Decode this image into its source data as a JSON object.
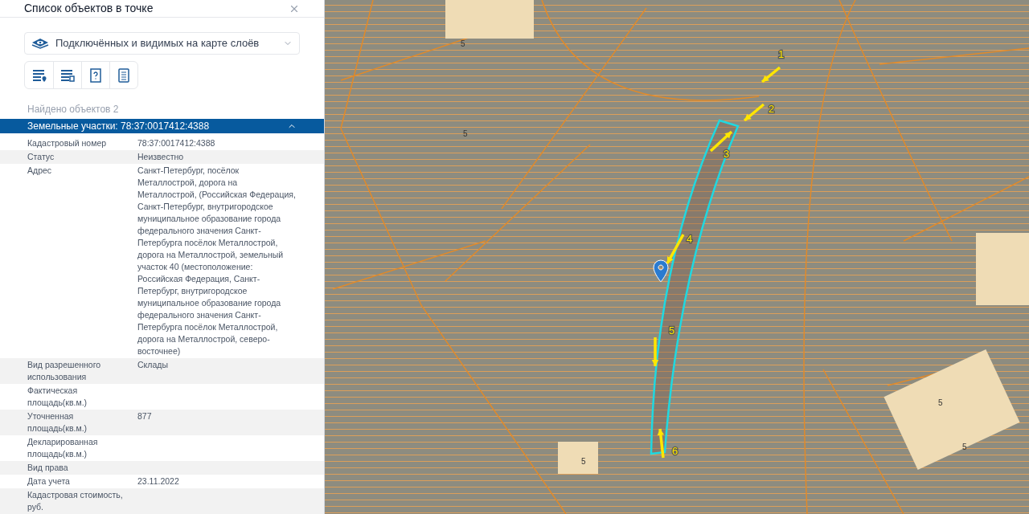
{
  "panel": {
    "title": "Список объектов в точке",
    "layer_select": {
      "value": "Подключённых и видимых на карте слоёв"
    },
    "tools": [
      {
        "kind": "list-pin"
      },
      {
        "kind": "list-frame"
      },
      {
        "kind": "query-frame"
      },
      {
        "kind": "document"
      }
    ],
    "found": "Найдено объектов 2",
    "section": {
      "title": "Земельные участки: 78:37:0017412:4388",
      "expanded": true
    },
    "attributes": [
      {
        "name": "Кадастровый номер",
        "value": "78:37:0017412:4388"
      },
      {
        "name": "Статус",
        "value": "Неизвестно"
      },
      {
        "name": "Адрес",
        "value": "Санкт-Петербург, посёлок Металлострой, дорога на Металлострой, (Российская Федерация, Санкт-Петербург, внутригородское муниципальное образование города федерального значения Санкт-Петербурга посёлок Металлострой, дорога на Металлострой, земельный участок 40 (местоположение: Российская Федерация, Санкт-Петербург, внутригородское муниципальное образование города федерального значения Санкт-Петербурга посёлок Металлострой, дорога на Металлострой, северо-восточнее)"
      },
      {
        "name": "Вид разрешенного использования",
        "value": "Склады"
      },
      {
        "name": "Фактическая площадь(кв.м.)"
      },
      {
        "name": "Уточненная площадь(кв.м.)",
        "value": "877"
      },
      {
        "name": "Декларированная площадь(кв.м.)"
      },
      {
        "name": "Вид права"
      },
      {
        "name": "Дата учета",
        "value": "23.11.2022"
      },
      {
        "name": "Кадастровая стоимость, руб."
      }
    ]
  },
  "map": {
    "arrows": [
      {
        "label": "1"
      },
      {
        "label": "2"
      },
      {
        "label": "3"
      },
      {
        "label": "4"
      },
      {
        "label": "5"
      },
      {
        "label": "6"
      }
    ],
    "parcel_labels": [
      "5",
      "5",
      "5",
      "5",
      "5"
    ]
  }
}
